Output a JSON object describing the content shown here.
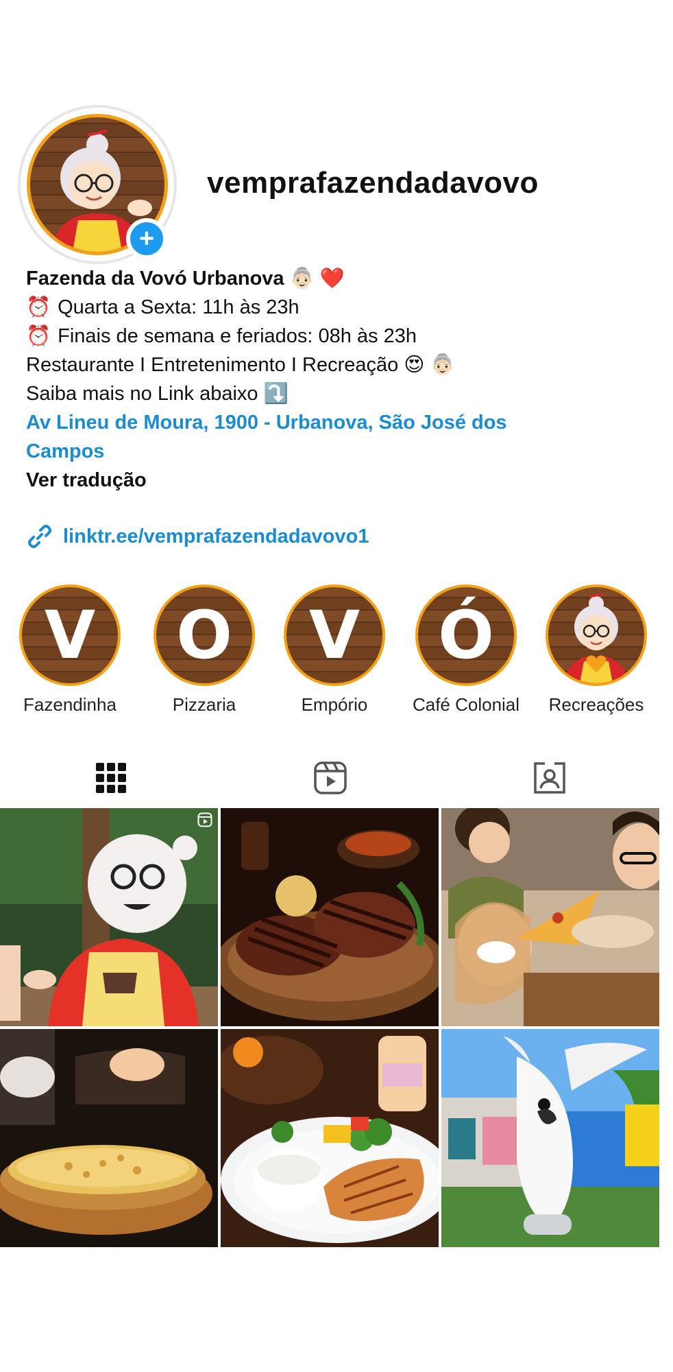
{
  "profile": {
    "username": "vemprafazendadavovo",
    "display_name": "Fazenda da Vovó Urbanova",
    "avatar_icon": "grandma-avatar",
    "add_story_icon": "plus-icon"
  },
  "bio": {
    "name_emojis": [
      "👵🏻",
      "❤️"
    ],
    "hours_1": "Quarta a Sexta: 11h às 23h",
    "hours_2": "Finais de semana e feriados: 08h às 23h",
    "hours_emoji": "⏰",
    "services": "Restaurante I Entretenimento I Recreação",
    "services_emojis": [
      "😍",
      "👵🏻"
    ],
    "link_hint": "Saiba mais no Link abaixo",
    "link_hint_emoji": "⤵️",
    "address": "Av Lineu de Moura, 1900 - Urbanova, São José dos Campos",
    "translate": "Ver tradução",
    "link": "linktr.ee/vemprafazendadavovo1"
  },
  "highlights": [
    {
      "letter": "V",
      "label": "Fazendinha"
    },
    {
      "letter": "O",
      "label": "Pizzaria"
    },
    {
      "letter": "V",
      "label": "Empório"
    },
    {
      "letter": "Ó",
      "label": "Café Colonial"
    },
    {
      "letter": "",
      "label": "Recreações",
      "icon": "grandma-heart-icon"
    }
  ],
  "tabs": [
    {
      "icon": "grid-icon",
      "active": true
    },
    {
      "icon": "reels-icon",
      "active": false
    },
    {
      "icon": "tagged-icon",
      "active": false
    }
  ],
  "posts": [
    {
      "subject": "mascot-grandma",
      "type": "reel"
    },
    {
      "subject": "grilled-steaks",
      "type": "image"
    },
    {
      "subject": "friends-eating-pizza",
      "type": "image"
    },
    {
      "subject": "pizza-on-board",
      "type": "image"
    },
    {
      "subject": "chicken-rice-plate",
      "type": "image"
    },
    {
      "subject": "white-cockatoo",
      "type": "image"
    }
  ],
  "colors": {
    "accent_link": "#1a8ccf",
    "ring_orange": "#f4a11a",
    "badge_blue": "#1d9bf0"
  }
}
